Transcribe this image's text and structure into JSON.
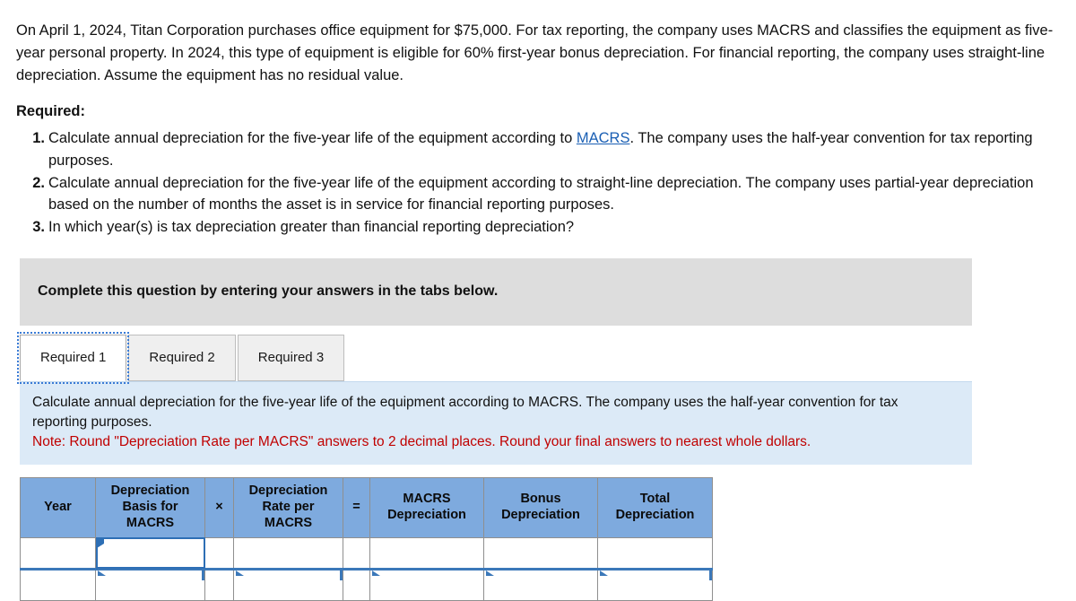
{
  "problem": {
    "statement": "On April 1, 2024, Titan Corporation purchases office equipment for $75,000. For tax reporting, the company uses MACRS and classifies the equipment as five-year personal property. In 2024, this type of equipment is eligible for 60% first-year bonus depreciation. For financial reporting, the company uses straight-line depreciation. Assume the equipment has no residual value.",
    "required_label": "Required:",
    "items": [
      {
        "before_link": "Calculate annual depreciation for the five-year life of the equipment according to ",
        "link": "MACRS",
        "after_link": ". The company uses the half-year convention for tax reporting purposes."
      },
      {
        "before_link": "Calculate annual depreciation for the five-year life of the equipment according to straight-line depreciation. The company uses partial-year depreciation based on the number of months the asset is in service for financial reporting purposes.",
        "link": "",
        "after_link": ""
      },
      {
        "before_link": "In which year(s) is tax depreciation greater than financial reporting depreciation?",
        "link": "",
        "after_link": ""
      }
    ]
  },
  "banner": {
    "text": "Complete this question by entering your answers in the tabs below."
  },
  "tabs": [
    {
      "label": "Required 1",
      "active": true
    },
    {
      "label": "Required 2",
      "active": false
    },
    {
      "label": "Required 3",
      "active": false
    }
  ],
  "instruction_panel": {
    "main": "Calculate annual depreciation for the five-year life of the equipment according to MACRS. The company uses the half-year convention for tax reporting purposes.",
    "note": "Note: Round \"Depreciation Rate per MACRS\" answers to 2 decimal places. Round your final answers to nearest whole dollars."
  },
  "answer_table": {
    "headers": [
      "Year",
      "Depreciation Basis for MACRS",
      "×",
      "Depreciation Rate per MACRS",
      "=",
      "MACRS Depreciation",
      "Bonus Depreciation",
      "Total Depreciation"
    ],
    "header_lines": {
      "year": [
        "Year"
      ],
      "basis": [
        "Depreciation",
        "Basis for",
        "MACRS"
      ],
      "mult": [
        "×"
      ],
      "rate": [
        "Depreciation",
        "Rate per",
        "MACRS"
      ],
      "eq": [
        "="
      ],
      "macrs": [
        "MACRS",
        "Depreciation"
      ],
      "bonus": [
        "Bonus",
        "Depreciation"
      ],
      "total": [
        "Total",
        "Depreciation"
      ]
    },
    "rows": [
      {
        "year": "",
        "basis": "",
        "mult": "",
        "rate": "",
        "eq": "",
        "macrs": "",
        "bonus": "",
        "total": ""
      },
      {
        "year": "",
        "basis": "",
        "mult": "",
        "rate": "",
        "eq": "",
        "macrs": "",
        "bonus": "",
        "total": ""
      }
    ]
  },
  "colors": {
    "header_blue": "#7eaade",
    "panel_blue": "#dceaf7",
    "banner_gray": "#dddddd",
    "note_red": "#c00000",
    "link_blue": "#1a5fb4",
    "selection_blue": "#2e6fb5"
  }
}
